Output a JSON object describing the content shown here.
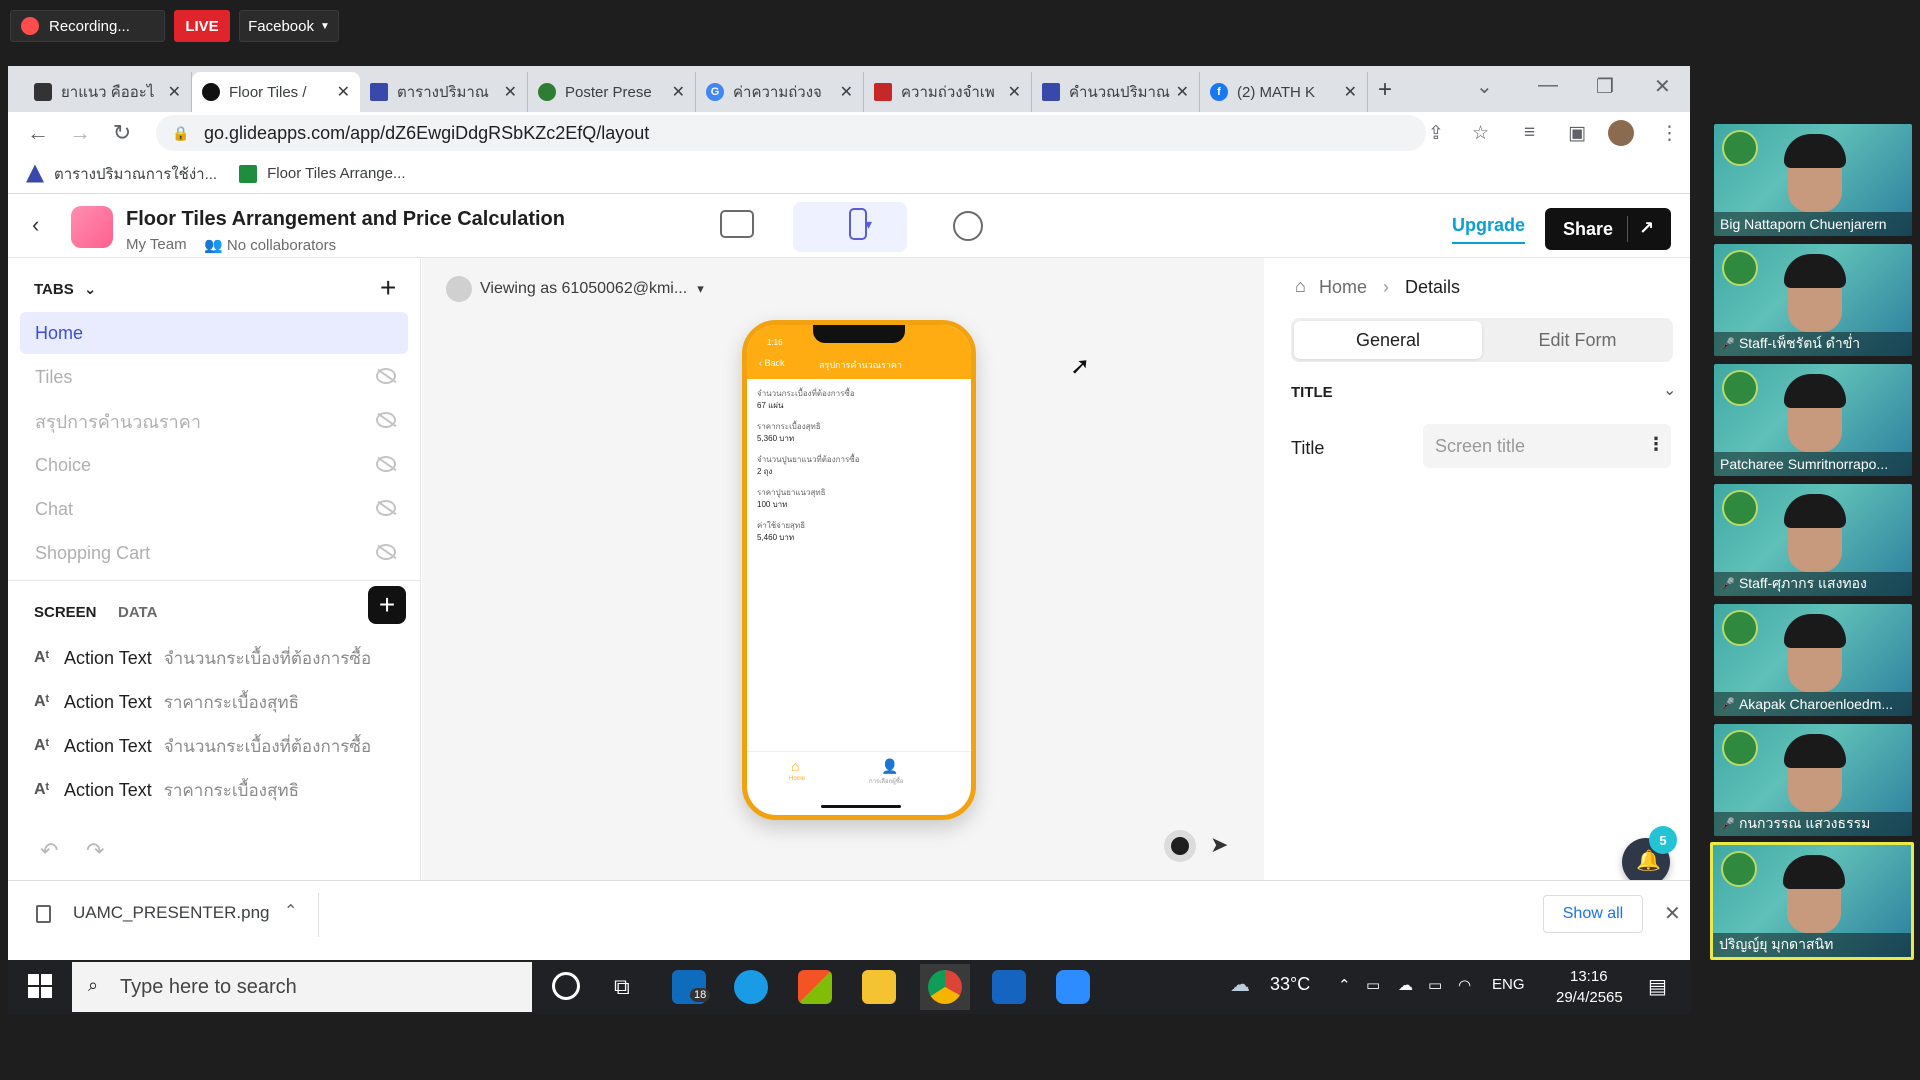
{
  "recording": {
    "status": "Recording...",
    "live": "LIVE",
    "platform": "Facebook"
  },
  "browser": {
    "tabs": [
      {
        "label": "ยาแนว คืออะไ",
        "color": "#333"
      },
      {
        "label": "Floor Tiles /",
        "color": "#111"
      },
      {
        "label": "ตารางปริมาณ",
        "color": "#3949ab"
      },
      {
        "label": "Poster Prese",
        "color": "#2e7d32"
      },
      {
        "label": "ค่าความถ่วงจ",
        "color": "#4285f4"
      },
      {
        "label": "ความถ่วงจำเพ",
        "color": "#c62828"
      },
      {
        "label": "คำนวณปริมาณ",
        "color": "#3949ab"
      },
      {
        "label": "(2) MATH K",
        "color": "#1877f2"
      }
    ],
    "url": "go.glideapps.com/app/dZ6EwgiDdgRSbKZc2EfQ/layout",
    "bookmarks": [
      {
        "label": "ตารางปริมาณการใช้ง่า..."
      },
      {
        "label": "Floor Tiles Arrange..."
      }
    ]
  },
  "app": {
    "title": "Floor Tiles Arrangement and Price Calculation",
    "team": "My Team",
    "collaborators": "No collaborators",
    "upgrade": "Upgrade",
    "share": "Share"
  },
  "left_panel": {
    "tabs_heading": "TABS",
    "nav_items": [
      {
        "label": "Home"
      },
      {
        "label": "Tiles"
      },
      {
        "label": "สรุปการคำนวณราคา"
      },
      {
        "label": "Choice"
      },
      {
        "label": "Chat"
      },
      {
        "label": "Shopping Cart"
      }
    ],
    "screen_tab": "SCREEN",
    "data_tab": "DATA",
    "components": [
      {
        "type": "Action Text",
        "value": "จำนวนกระเบื้องที่ต้องการซื้อ"
      },
      {
        "type": "Action Text",
        "value": "ราคากระเบื้องสุทธิ"
      },
      {
        "type": "Action Text",
        "value": "จำนวนกระเบื้องที่ต้องการซื้อ"
      },
      {
        "type": "Action Text",
        "value": "ราคากระเบื้องสุทธิ"
      }
    ]
  },
  "canvas": {
    "viewing_as": "Viewing as 61050062@kmi...",
    "phone": {
      "time": "1:16",
      "back": "Back",
      "title": "สรุปการคำนวณราคา",
      "fields": [
        {
          "label": "จำนวนกระเบื้องที่ต้องการซื้อ",
          "value": "67 แผ่น"
        },
        {
          "label": "ราคากระเบื้องสุทธิ",
          "value": "5,360 บาท"
        },
        {
          "label": "จำนวนปูนยาแนวที่ต้องการซื้อ",
          "value": "2 ถุง"
        },
        {
          "label": "ราคาปูนยาแนวสุทธิ",
          "value": "100 บาท"
        },
        {
          "label": "ค่าใช้จ่ายสุทธิ",
          "value": "5,460 บาท"
        }
      ],
      "tab_home": "Home",
      "tab_other": "การเลือกผู้ซื้อ"
    }
  },
  "right_panel": {
    "breadcrumb_home": "Home",
    "breadcrumb_current": "Details",
    "seg_general": "General",
    "seg_edit": "Edit Form",
    "section": "TITLE",
    "title_label": "Title",
    "title_placeholder": "Screen title",
    "notification_count": "5"
  },
  "downloads": {
    "file": "UAMC_PRESENTER.png",
    "show_all": "Show all"
  },
  "taskbar": {
    "search_placeholder": "Type here to search",
    "mail_badge": "18",
    "temperature": "33°C",
    "language": "ENG",
    "time": "13:16",
    "date": "29/4/2565"
  },
  "participants": [
    {
      "name": "Big Nattaporn Chuenjarern",
      "muted": false
    },
    {
      "name": "Staff-เพ็ชรัตน์ ดำข่ำ",
      "muted": true
    },
    {
      "name": "Patcharee Sumritnorrapo...",
      "muted": false
    },
    {
      "name": "Staff-ศุภากร แสงทอง",
      "muted": true
    },
    {
      "name": "Akapak Charoenloedm...",
      "muted": true
    },
    {
      "name": "กนกวรรณ แสวงธรรม",
      "muted": true
    },
    {
      "name": "ปริญญ์ยุ มุกดาสนิท",
      "muted": false
    }
  ]
}
